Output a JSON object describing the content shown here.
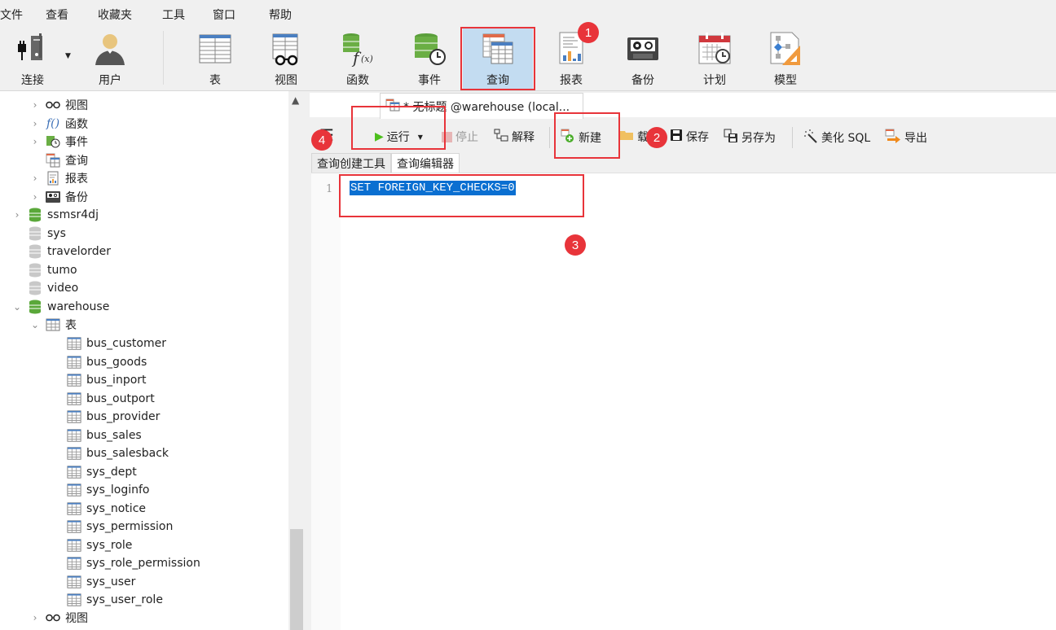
{
  "menu": [
    "文件",
    "查看",
    "收藏夹",
    "工具",
    "窗口",
    "帮助"
  ],
  "toolbar": {
    "connect": "连接",
    "user": "用户",
    "table": "表",
    "view": "视图",
    "function": "函数",
    "event": "事件",
    "query": "查询",
    "report": "报表",
    "backup": "备份",
    "schedule": "计划",
    "model": "模型"
  },
  "tree": {
    "db_children_top": [
      "视图",
      "函数",
      "事件",
      "查询",
      "报表",
      "备份"
    ],
    "databases": [
      "ssmsr4dj",
      "sys",
      "travelorder",
      "tumo",
      "video",
      "warehouse"
    ],
    "tables_label": "表",
    "tables": [
      "bus_customer",
      "bus_goods",
      "bus_inport",
      "bus_outport",
      "bus_provider",
      "bus_sales",
      "bus_salesback",
      "sys_dept",
      "sys_loginfo",
      "sys_notice",
      "sys_permission",
      "sys_role",
      "sys_role_permission",
      "sys_user",
      "sys_user_role"
    ],
    "views_label": "视图"
  },
  "doc_tab": {
    "title": "* 无标题 @warehouse (local..."
  },
  "query_toolbar": {
    "run": "运行",
    "stop": "停止",
    "explain": "解释",
    "new": "新建",
    "load": "载",
    "save": "保存",
    "save_as": "另存为",
    "beautify": "美化 SQL",
    "export": "导出"
  },
  "subtabs": [
    "查询创建工具",
    "查询编辑器"
  ],
  "editor": {
    "line_number": "1",
    "code": "SET FOREIGN_KEY_CHECKS=0"
  },
  "badges": [
    "1",
    "2",
    "3",
    "4"
  ],
  "colors": {
    "annotation_red": "#e8343a",
    "selection_blue": "#0a6fd1",
    "active_tool_bg": "#c3dcf1"
  }
}
